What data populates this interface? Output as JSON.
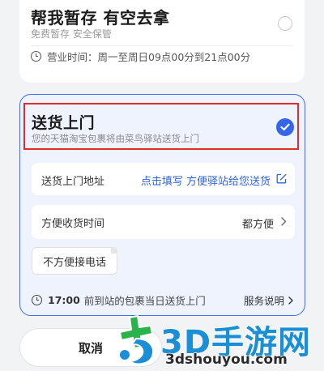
{
  "pickup_option": {
    "title": "帮我暂存 有空去拿",
    "subtitle": "免费暂存 安全保管",
    "hours": "营业时间：周一至周日09点00分到21点00分",
    "selected": false
  },
  "delivery_option": {
    "title": "送货上门",
    "subtitle": "您的天猫淘宝包裹将由菜鸟驿站送货上门",
    "selected": true,
    "address_label": "送货上门地址",
    "address_link": "点击填写 方便驿站给您送货",
    "time_label": "方便收货时间",
    "time_value": "都方便",
    "phone_chip": "不方便接电话",
    "deadline": "17:00",
    "deadline_note": "前到站的包裹当日送货上门",
    "service_link": "服务说明"
  },
  "buttons": {
    "cancel": "取消"
  },
  "watermark": {
    "brand": "3D手游网",
    "url": "3dshouyou.com"
  },
  "colors": {
    "accent_blue": "#3565ea",
    "highlight_red": "#e32b2b",
    "selected_bg": "#eef3fe"
  }
}
